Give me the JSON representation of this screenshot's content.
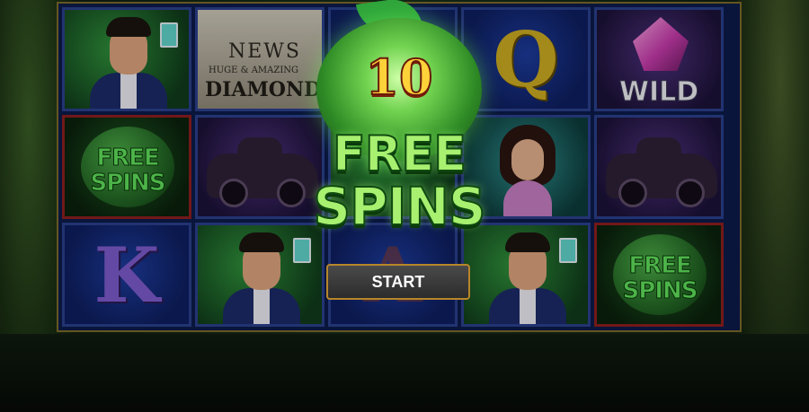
{
  "reels": {
    "symbols": {
      "q": "Q",
      "k": "K",
      "a": "A",
      "wild": "WILD",
      "free_spins_l1": "FREE",
      "free_spins_l2": "SPINS",
      "news_title": "NEWS",
      "news_sub": "HUGE & AMAZING",
      "news_headline": "DIAMOND"
    }
  },
  "popup": {
    "count": "10",
    "title_line1": "FREE",
    "title_line2": "SPINS",
    "start_label": "START"
  },
  "colors": {
    "accent_green": "#a8f070",
    "count_gold": "#ffd23a",
    "button_border": "#b8862a"
  },
  "icons": [
    "gangster-man-icon",
    "newspaper-icon",
    "wild-diamond-icon",
    "vintage-car-icon",
    "woman-martini-icon"
  ]
}
